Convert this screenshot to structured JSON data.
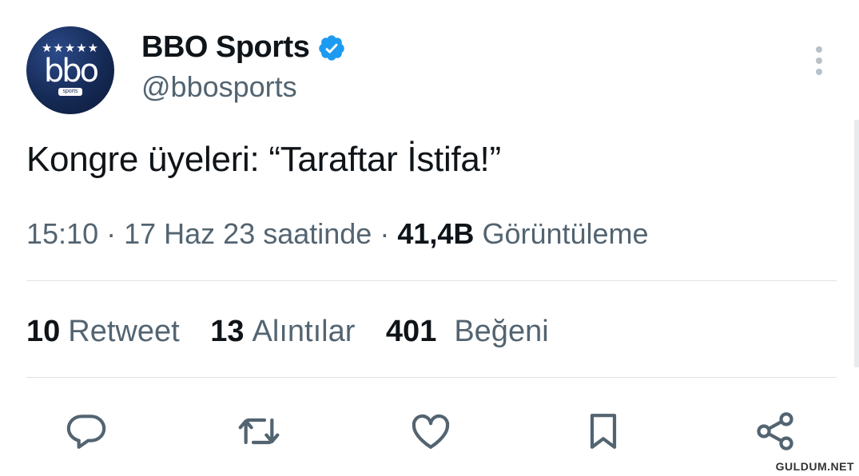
{
  "user": {
    "name": "BBO Sports",
    "handle": "@bbosports",
    "avatar_stars": "★★★★★",
    "avatar_mono": "bbo",
    "avatar_sub": "sports",
    "verified_color": "#1d9bf0"
  },
  "tweet": {
    "text": "Kongre üyeleri: “Taraftar İstifa!”",
    "time": "15:10",
    "date": "17 Haz 23 saatinde",
    "views_count": "41,4B",
    "views_label": "Görüntüleme"
  },
  "stats": [
    {
      "count": "10",
      "label": "Retweet"
    },
    {
      "count": "13",
      "label": "Alıntılar"
    },
    {
      "count": "401",
      "label": "Beğeni"
    }
  ],
  "actions": [
    "reply-icon",
    "retweet-icon",
    "like-icon",
    "bookmark-icon",
    "share-icon"
  ],
  "watermark": "GULDUM.NET"
}
